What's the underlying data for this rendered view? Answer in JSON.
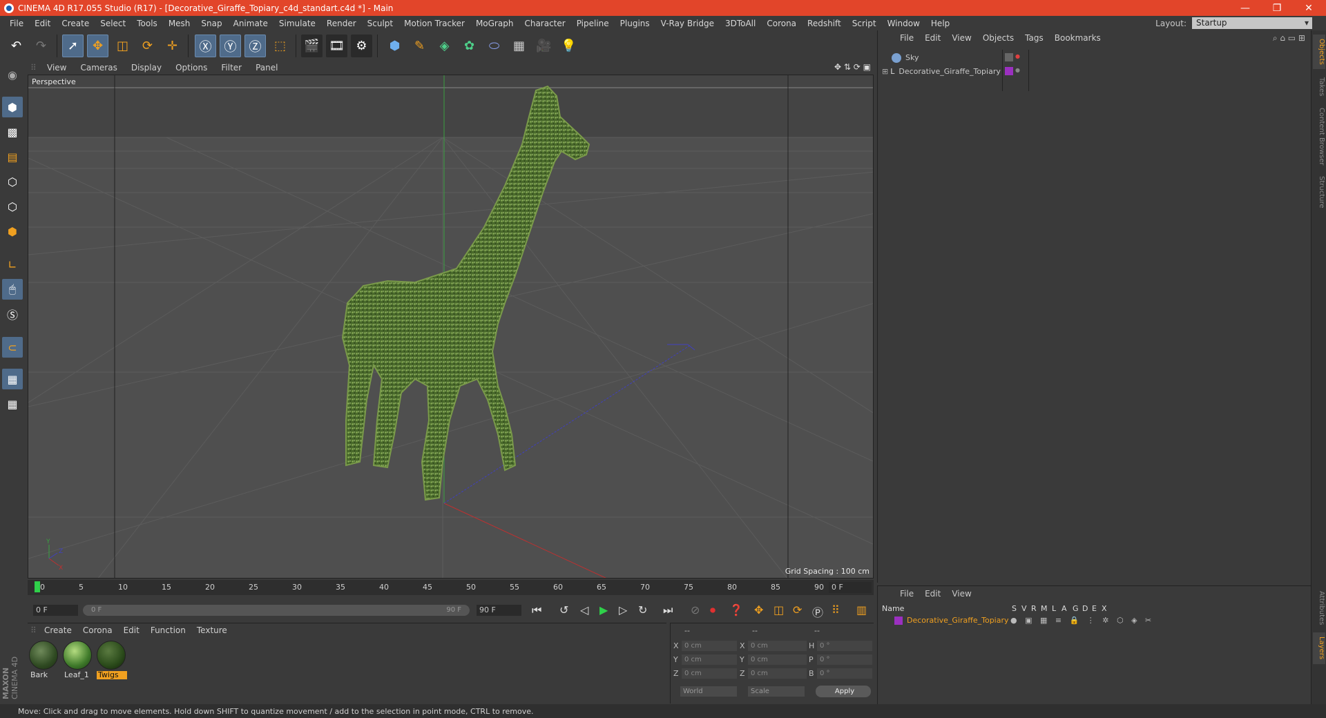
{
  "window": {
    "title": "CINEMA 4D R17.055 Studio (R17) - [Decorative_Giraffe_Topiary_c4d_standart.c4d *] - Main",
    "minimize": "—",
    "restore": "❐",
    "close": "✕"
  },
  "menu": [
    "File",
    "Edit",
    "Create",
    "Select",
    "Tools",
    "Mesh",
    "Snap",
    "Animate",
    "Simulate",
    "Render",
    "Sculpt",
    "Motion Tracker",
    "MoGraph",
    "Character",
    "Pipeline",
    "Plugins",
    "V-Ray Bridge",
    "3DToAll",
    "Corona",
    "Redshift",
    "Script",
    "Window",
    "Help"
  ],
  "layout": {
    "label": "Layout:",
    "value": "Startup"
  },
  "viewport": {
    "menu": [
      "View",
      "Cameras",
      "Display",
      "Options",
      "Filter",
      "Panel"
    ],
    "name": "Perspective",
    "grid_spacing": "Grid Spacing : 100 cm"
  },
  "timeline": {
    "ticks": [
      "0",
      "5",
      "10",
      "15",
      "20",
      "25",
      "30",
      "35",
      "40",
      "45",
      "50",
      "55",
      "60",
      "65",
      "70",
      "75",
      "80",
      "85",
      "90"
    ],
    "current_frame": "0 F",
    "start": "0 F",
    "range_start": "0 F",
    "range_end": "90 F",
    "end": "90 F"
  },
  "materials": {
    "menu": [
      "Create",
      "Corona",
      "Edit",
      "Function",
      "Texture"
    ],
    "items": [
      {
        "name": "Bark",
        "selected": false
      },
      {
        "name": "Leaf_1",
        "selected": false
      },
      {
        "name": "Twigs",
        "selected": true
      }
    ]
  },
  "coords": {
    "headers": [
      "--",
      "--",
      "--"
    ],
    "rows": [
      {
        "a": "X",
        "av": "0 cm",
        "b": "X",
        "bv": "0 cm",
        "c": "H",
        "cv": "0 °"
      },
      {
        "a": "Y",
        "av": "0 cm",
        "b": "Y",
        "bv": "0 cm",
        "c": "P",
        "cv": "0 °"
      },
      {
        "a": "Z",
        "av": "0 cm",
        "b": "Z",
        "bv": "0 cm",
        "c": "B",
        "cv": "0 °"
      }
    ],
    "mode1": "World",
    "mode2": "Scale",
    "apply": "Apply"
  },
  "objects": {
    "menu": [
      "File",
      "Edit",
      "View",
      "Objects",
      "Tags",
      "Bookmarks"
    ],
    "items": [
      "Sky",
      "Decorative_Giraffe_Topiary"
    ]
  },
  "layers": {
    "menu": [
      "File",
      "Edit",
      "View"
    ],
    "col_name": "Name",
    "cols": [
      "S",
      "V",
      "R",
      "M",
      "L",
      "A",
      "G",
      "D",
      "E",
      "X"
    ],
    "items": [
      "Decorative_Giraffe_Topiary"
    ]
  },
  "right_tabs": [
    "Objects",
    "Takes",
    "Content Browser",
    "Structure",
    "Attributes",
    "Layers"
  ],
  "status": "Move: Click and drag to move elements. Hold down SHIFT to quantize movement / add to the selection in point mode, CTRL to remove.",
  "brand": {
    "a": "MAXON",
    "b": "CINEMA 4D"
  },
  "colors": {
    "titlebar": "#e2452a",
    "accent": "#f0a020",
    "layer_color": "#9b30c0"
  }
}
